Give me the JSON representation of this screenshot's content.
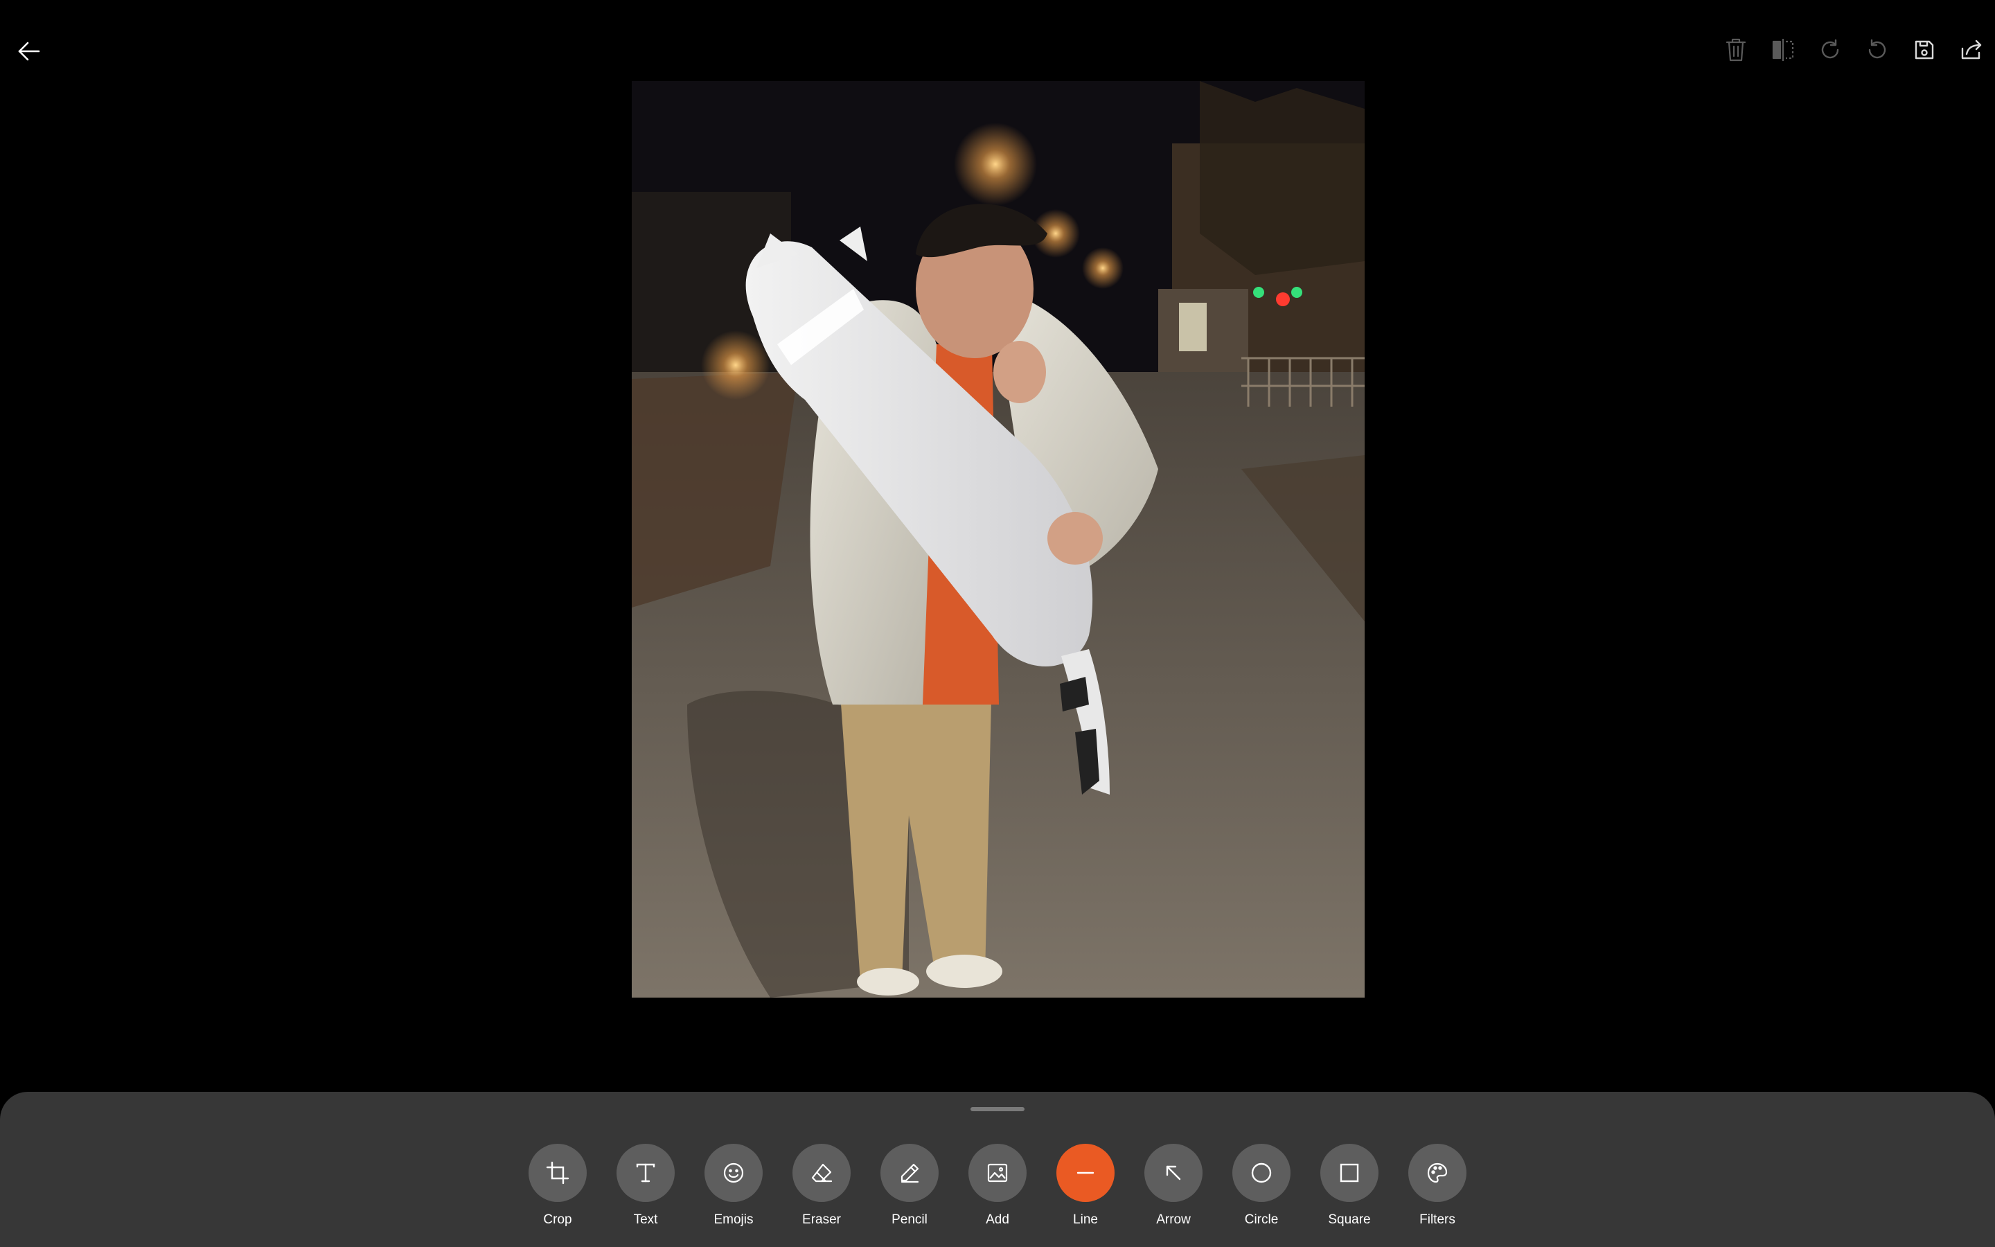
{
  "window": {
    "title": ""
  },
  "top_bar": {
    "back_icon": "arrow-left-icon",
    "actions": [
      {
        "id": "delete",
        "icon": "trash-icon",
        "enabled": false
      },
      {
        "id": "flip",
        "icon": "flip-horizontal-icon",
        "enabled": false
      },
      {
        "id": "redo",
        "icon": "redo-icon",
        "enabled": false
      },
      {
        "id": "undo",
        "icon": "undo-icon",
        "enabled": false
      },
      {
        "id": "save",
        "icon": "save-icon",
        "enabled": true
      },
      {
        "id": "share",
        "icon": "share-icon",
        "enabled": true
      }
    ]
  },
  "tools": [
    {
      "label": "Crop",
      "icon": "crop-icon",
      "active": false
    },
    {
      "label": "Text",
      "icon": "text-icon",
      "active": false
    },
    {
      "label": "Emojis",
      "icon": "emoji-icon",
      "active": false
    },
    {
      "label": "Eraser",
      "icon": "eraser-icon",
      "active": false
    },
    {
      "label": "Pencil",
      "icon": "pencil-icon",
      "active": false
    },
    {
      "label": "Add",
      "icon": "image-icon",
      "active": false
    },
    {
      "label": "Line",
      "icon": "line-icon",
      "active": true
    },
    {
      "label": "Arrow",
      "icon": "arrow-up-left-icon",
      "active": false
    },
    {
      "label": "Circle",
      "icon": "circle-icon",
      "active": false
    },
    {
      "label": "Square",
      "icon": "square-icon",
      "active": false
    },
    {
      "label": "Filters",
      "icon": "palette-icon",
      "active": false
    }
  ],
  "colors": {
    "background": "#000000",
    "panel": "#373737",
    "tool_button": "#5e5e5e",
    "accent": "#ea5a23",
    "disabled_icon": "#5a5a5a"
  }
}
